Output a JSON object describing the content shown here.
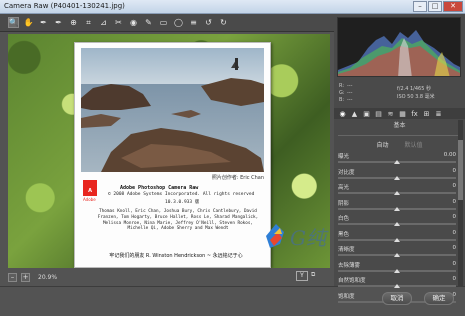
{
  "window": {
    "title": "Camera Raw (P40401-130241.jpg)",
    "min_label": "–",
    "max_label": "□",
    "close_label": "✕"
  },
  "toolbar": {
    "tools": [
      "zoom-icon",
      "hand-icon",
      "white-balance-icon",
      "color-sampler-icon",
      "targeted-adjust-icon",
      "crop-icon",
      "straighten-icon",
      "spot-removal-icon",
      "red-eye-icon",
      "adjustment-brush-icon",
      "graduated-filter-icon",
      "radial-filter-icon",
      "menu-icon",
      "rotate-left-icon",
      "rotate-right-icon"
    ],
    "glyphs": [
      "🔍",
      "✋",
      "✒",
      "✒",
      "⊕",
      "⌗",
      "⊿",
      "✂",
      "◉",
      "✎",
      "▭",
      "◯",
      "≡",
      "↺",
      "↻"
    ]
  },
  "splash": {
    "photo_credit": "照片创作者: Eric Chan",
    "adobe_logo": "A",
    "adobe_text": "Adobe",
    "product_title": "Adobe Photoshop Camera Raw",
    "copyright": "© 2008 Adobe Systems Incorporated. All rights reserved",
    "version": "10.3.0.933 版",
    "credits": "Thomas Knoll, Eric Chan, Joshua Bury, Chris Cantlebury, David Franzen, Tom Hogarty, Bruce Hallet, Ross Le, Sharad Mangalick, Melissa Monroe, Nina Marie, Jeffrey O'Neill, Steven Rokos, Michelle Qi, Adobe Sherry and Max Wendt",
    "dedication": "牢记我们的朋友 R. Winston Hendrickson ~ 永远铭记于心"
  },
  "watermark": {
    "text": "G纯"
  },
  "bottombar": {
    "zoom_minus": "–",
    "zoom_plus": "+",
    "zoom_value": "20.9%",
    "y_label": "Y",
    "compare_label": "⧉"
  },
  "info": {
    "r_label": "R:",
    "g_label": "G:",
    "b_label": "B:",
    "dash": "---",
    "exposure": "f/2.4  1/465 秒",
    "iso": "ISO 50   3.8 毫米"
  },
  "panel": {
    "tabs": [
      "◉",
      "▲",
      "▣",
      "▤",
      "≋",
      "▦",
      "fx",
      "⊞",
      "≣"
    ],
    "header": "基本",
    "wb_label": "白平衡",
    "auto_label": "自动",
    "default_label": "默认值",
    "sliders": [
      {
        "label": "曝光",
        "value": "0.00",
        "pos": 0.5
      },
      {
        "label": "对比度",
        "value": "0",
        "pos": 0.5
      },
      {
        "label": "高光",
        "value": "0",
        "pos": 0.5
      },
      {
        "label": "阴影",
        "value": "0",
        "pos": 0.5
      },
      {
        "label": "白色",
        "value": "0",
        "pos": 0.5
      },
      {
        "label": "黑色",
        "value": "0",
        "pos": 0.5
      },
      {
        "label": "清晰度",
        "value": "0",
        "pos": 0.5
      },
      {
        "label": "去除薄雾",
        "value": "0",
        "pos": 0.5
      },
      {
        "label": "自然饱和度",
        "value": "0",
        "pos": 0.5
      },
      {
        "label": "饱和度",
        "value": "0",
        "pos": 0.5
      }
    ]
  },
  "buttons": {
    "cancel": "取消",
    "ok": "确定"
  },
  "colors": {
    "accent": "#e8261f",
    "panel": "#4a4a4a",
    "background": "#535353"
  }
}
